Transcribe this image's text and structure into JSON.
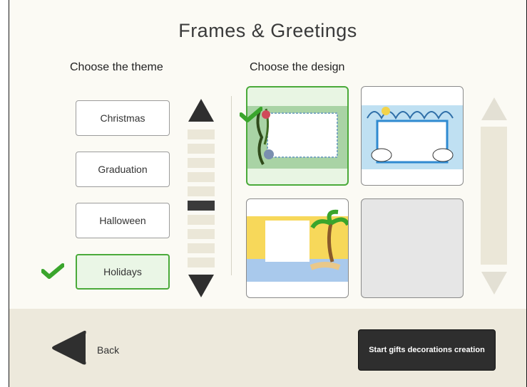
{
  "title": "Frames & Greetings",
  "theme_panel": {
    "heading": "Choose the theme",
    "themes": [
      {
        "label": "Christmas",
        "selected": false
      },
      {
        "label": "Graduation",
        "selected": false
      },
      {
        "label": "Halloween",
        "selected": false
      },
      {
        "label": "Holidays",
        "selected": true
      }
    ],
    "scroll": {
      "position_index": 5,
      "segment_count": 11
    }
  },
  "design_panel": {
    "heading": "Choose the design",
    "designs": [
      {
        "name": "plant-frame",
        "selected": true
      },
      {
        "name": "snow-sheep-frame",
        "selected": false
      },
      {
        "name": "beach-palm-frame",
        "selected": false
      },
      {
        "name": "empty-slot",
        "selected": false
      }
    ]
  },
  "footer": {
    "back_label": "Back",
    "start_label": "Start gifts decorations creation"
  },
  "colors": {
    "accent_green": "#4aaa3a",
    "dark": "#2e2e2e",
    "background": "#fbfaf4",
    "footer_bg": "#ede9dc"
  },
  "icons": [
    "check-icon",
    "up-arrow-icon",
    "down-arrow-icon",
    "back-arrow-icon"
  ]
}
